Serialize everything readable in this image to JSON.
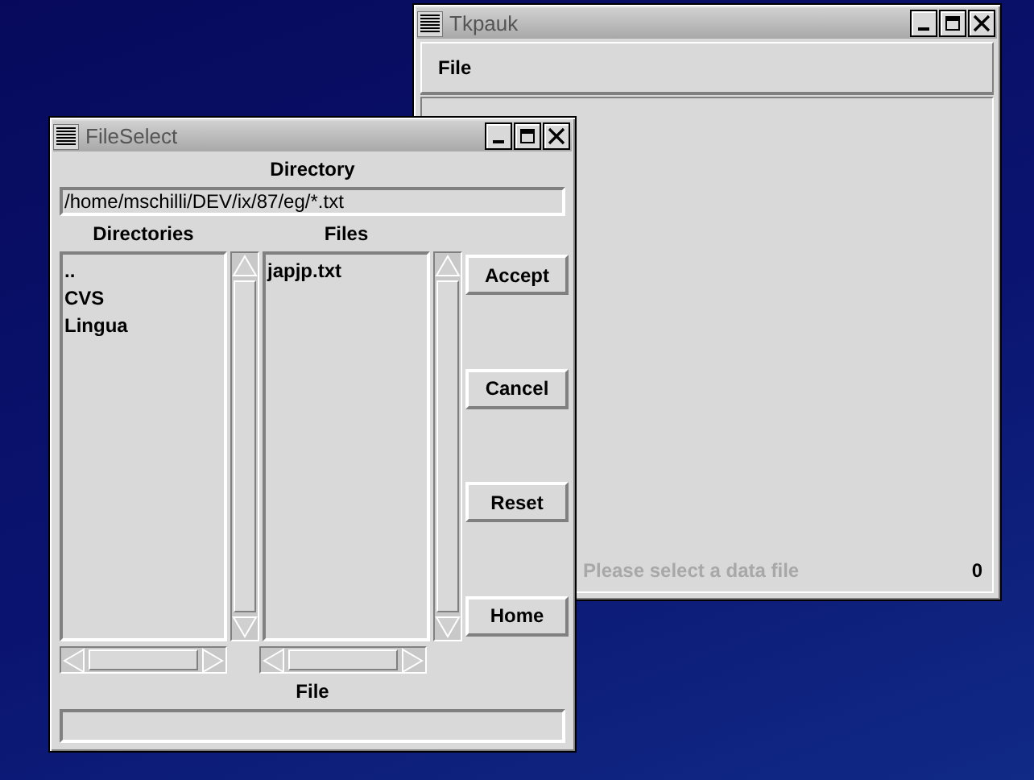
{
  "main_window": {
    "title": "Tkpauk",
    "menu": [
      "File"
    ],
    "status": {
      "message": "Please select a data file",
      "count": "0"
    }
  },
  "file_dialog": {
    "title": "FileSelect",
    "directory_label": "Directory",
    "path": "/home/mschilli/DEV/ix/87/eg/*.txt",
    "directories_label": "Directories",
    "files_label": "Files",
    "directories": [
      "..",
      "CVS",
      "Lingua"
    ],
    "files": [
      "japjp.txt"
    ],
    "buttons": [
      "Accept",
      "Cancel",
      "Reset",
      "Home"
    ],
    "file_label": "File"
  }
}
